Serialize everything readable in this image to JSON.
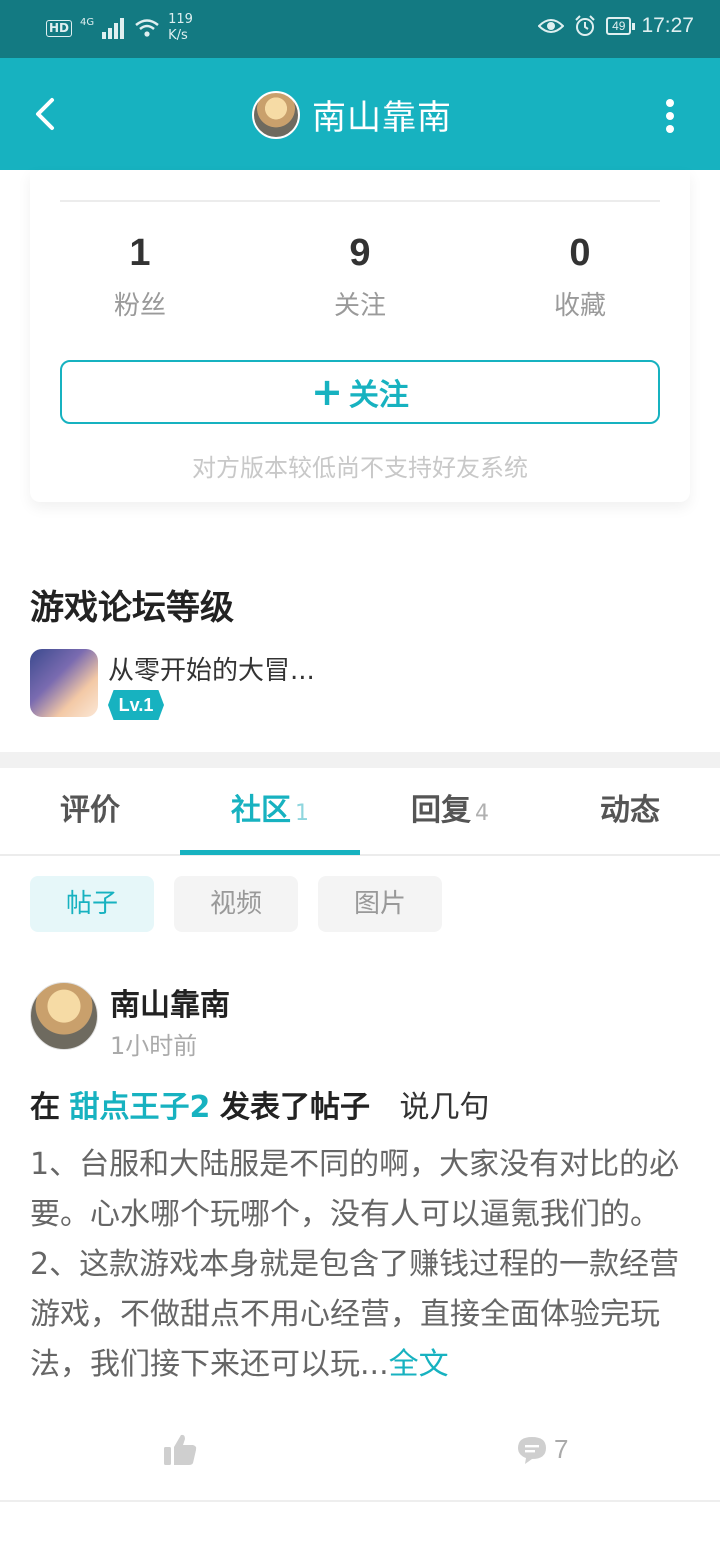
{
  "status_bar": {
    "hd": "HD",
    "network": "4G",
    "speed_value": "119",
    "speed_unit": "K/s",
    "battery": "49",
    "time": "17:27"
  },
  "header": {
    "title": "南山靠南"
  },
  "profile": {
    "stats": [
      {
        "value": "1",
        "label": "粉丝"
      },
      {
        "value": "9",
        "label": "关注"
      },
      {
        "value": "0",
        "label": "收藏"
      }
    ],
    "follow_label": "关注",
    "note": "对方版本较低尚不支持好友系统"
  },
  "forum": {
    "title": "游戏论坛等级",
    "game_name": "从零开始的大冒...",
    "level": "Lv.1"
  },
  "tabs": [
    {
      "label": "评价",
      "count": ""
    },
    {
      "label": "社区",
      "count": "1"
    },
    {
      "label": "回复",
      "count": "4"
    },
    {
      "label": "动态",
      "count": ""
    }
  ],
  "chips": [
    "帖子",
    "视频",
    "图片"
  ],
  "post": {
    "user": "南山靠南",
    "time": "1小时前",
    "prefix": "在",
    "game": "甜点王子2",
    "action": "发表了帖子",
    "title": "说几句",
    "body": "1、台服和大陆服是不同的啊，大家没有对比的必要。心水哪个玩哪个，没有人可以逼氪我们的。2、这款游戏本身就是包含了赚钱过程的一款经营游戏，不做甜点不用心经营，直接全面体验完玩法，我们接下来还可以玩...",
    "more": "全文",
    "comments": "7"
  },
  "colors": {
    "primary": "#17b2c0",
    "status_bar": "#137a82"
  }
}
